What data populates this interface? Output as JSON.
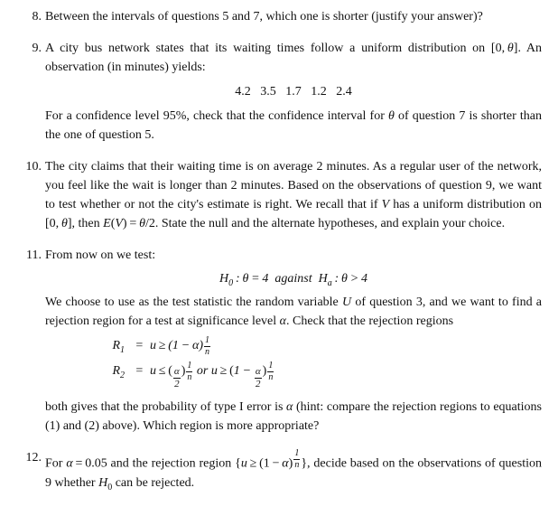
{
  "questions": [
    {
      "number": "8.",
      "text": "Between the intervals of questions 5 and 7, which one is shorter (justify your answer)?"
    },
    {
      "number": "9.",
      "para1": "A city bus network states that its waiting times follow a uniform distribution on [0, θ]. An observation (in minutes) yields:",
      "data": "4.2   3.5   1.7   1.2   2.4",
      "para2": "For a confidence level 95%, check that the confidence interval for θ of question 7 is shorter than the one of question 5."
    },
    {
      "number": "10.",
      "text": "The city claims that their waiting time is on average 2 minutes. As a regular user of the network, you feel like the wait is longer than 2 minutes. Based on the observations of question 9, we want to test whether or not the city's estimate is right. We recall that if V has a uniform distribution on [0, θ], then E(V) = θ/2. State the null and the alternate hypotheses, and explain your choice."
    },
    {
      "number": "11.",
      "para1": "From now on we test:",
      "hypothesis": "H₀ : θ = 4 against Hₐ : θ > 4",
      "para2": "We choose to use as the test statistic the random variable U of question 3, and we want to find a rejection region for a test at significance level α. Check that the rejection regions",
      "para3": "both gives that the probability of type I error is α (hint: compare the rejection regions to equations (1) and (2) above). Which region is more appropriate?"
    },
    {
      "number": "12.",
      "text": "For α = 0.05 and the rejection region {u ≥ (1 − α)^(1/n)}, decide based on the observations of question 9 whether H₀ can be rejected."
    }
  ]
}
